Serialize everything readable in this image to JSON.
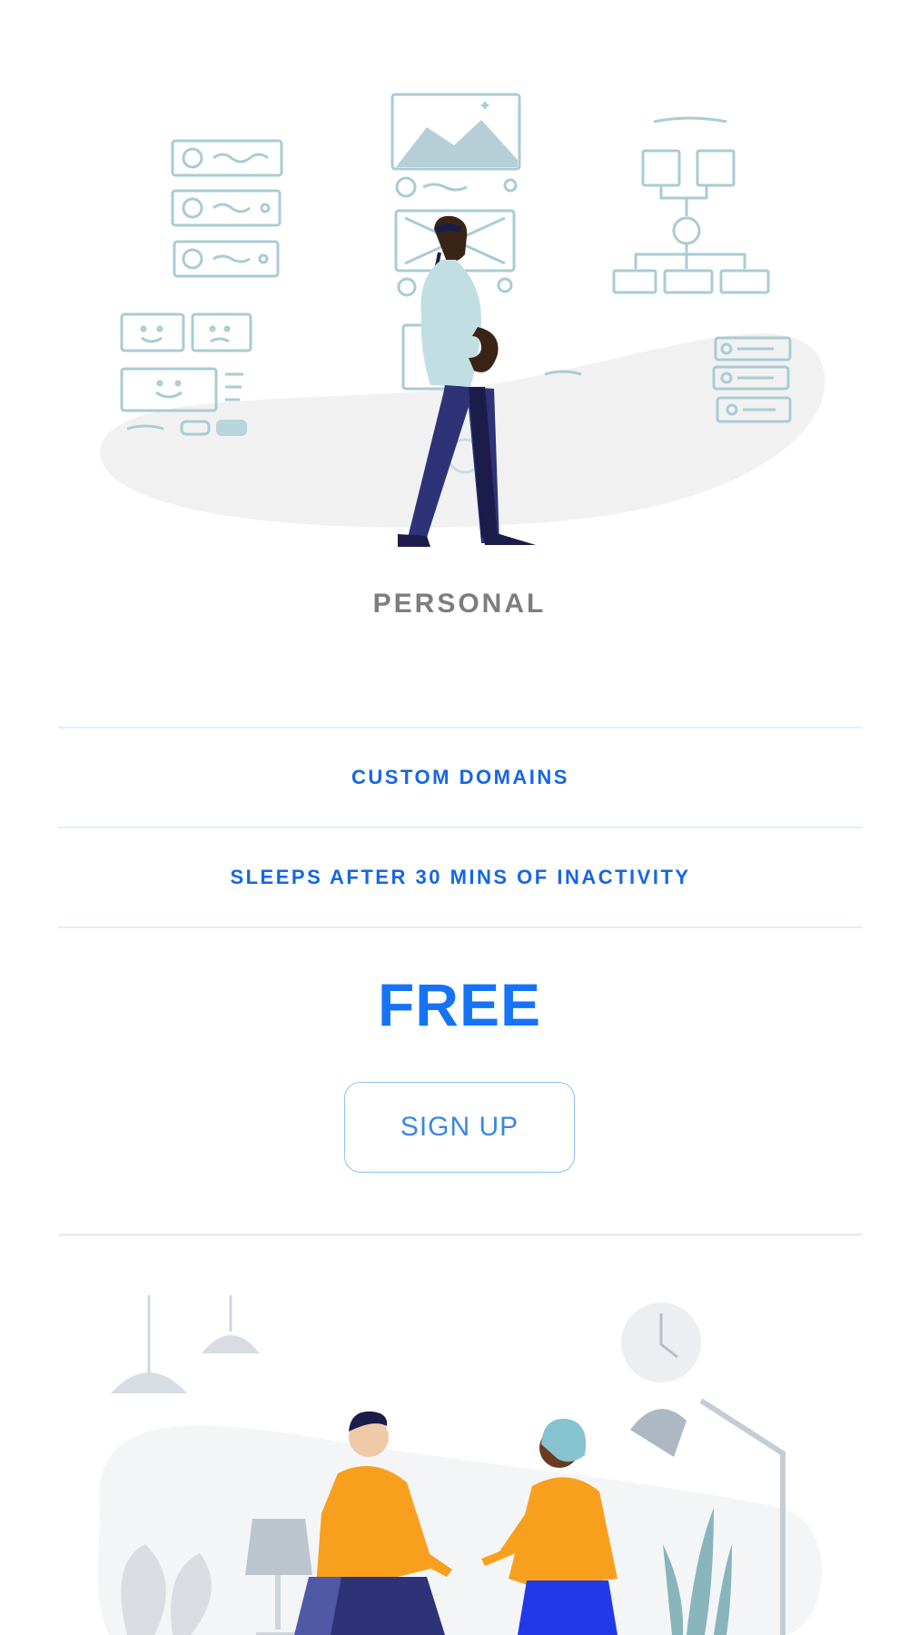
{
  "plan": {
    "title": "PERSONAL",
    "features": [
      "CUSTOM DOMAINS",
      "SLEEPS AFTER 30 MINS OF INACTIVITY"
    ],
    "price": "FREE",
    "cta_label": "SIGN UP"
  },
  "colors": {
    "accent_blue": "#1673f5",
    "feature_blue": "#1666e4",
    "divider": "#e3eef8",
    "title_gray": "#7d7d7d"
  }
}
